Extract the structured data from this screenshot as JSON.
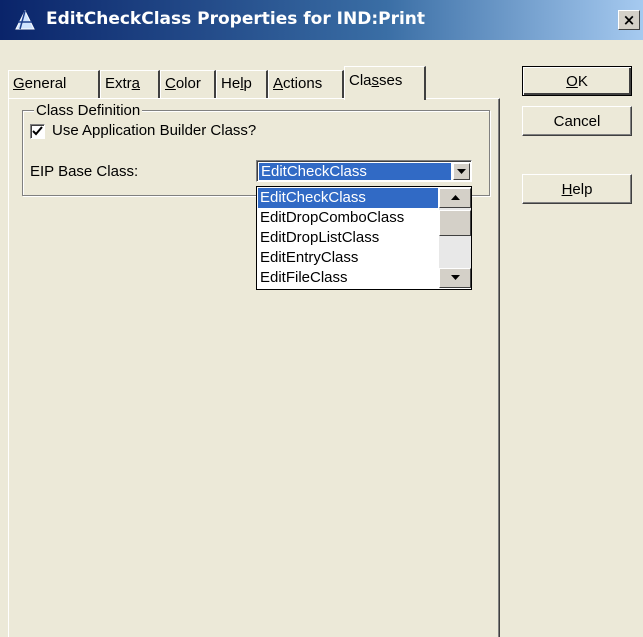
{
  "window": {
    "title": "EditCheckClass Properties for IND:Print",
    "close_glyph": "×"
  },
  "tabs": [
    {
      "label": "General",
      "mnemonic": "G",
      "rest": "eneral"
    },
    {
      "label": "Extra",
      "mnemonic": "a",
      "pre": "Extr"
    },
    {
      "label": "Color",
      "mnemonic": "C",
      "rest": "olor"
    },
    {
      "label": "Help",
      "mnemonic": "l",
      "pre": "He",
      "rest": "p"
    },
    {
      "label": "Actions",
      "mnemonic": "A",
      "rest": "ctions"
    },
    {
      "label": "Classes",
      "mnemonic": "s",
      "pre": "Cla",
      "rest": "ses",
      "active": true
    }
  ],
  "class_definition": {
    "group_label": "Class Definition",
    "use_app_builder_label": "Use Application Builder Class?",
    "use_app_builder_checked": true,
    "eip_label": "EIP Base Class:",
    "eip_value": "EditCheckClass",
    "eip_options": [
      "EditCheckClass",
      "EditDropComboClass",
      "EditDropListClass",
      "EditEntryClass",
      "EditFileClass"
    ],
    "eip_selected_index": 0
  },
  "buttons": {
    "ok_mnemonic": "O",
    "ok_rest": "K",
    "cancel": "Cancel",
    "help_mnemonic": "H",
    "help_rest": "elp"
  },
  "colors": {
    "titlebar": "#0a246a",
    "selection": "#316ac5",
    "face": "#ece9d8"
  }
}
